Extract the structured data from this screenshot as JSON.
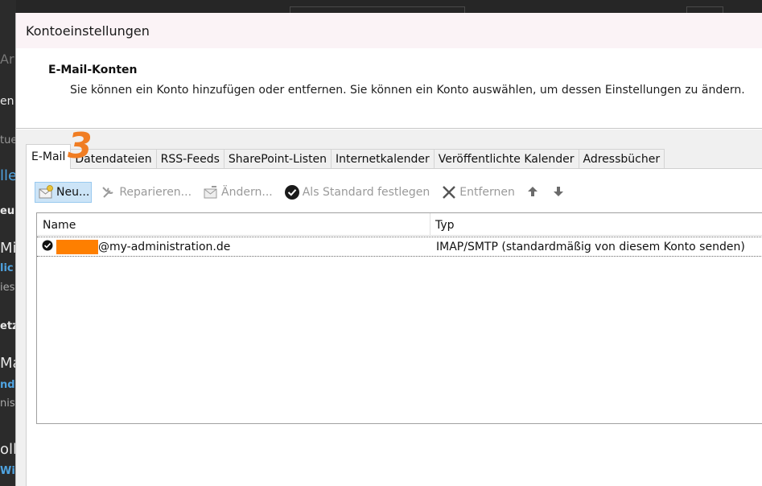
{
  "background": {
    "fragments": [
      "Ar",
      "en",
      "tue",
      "lle",
      "eu",
      "Mic",
      "lic",
      "ies",
      "etz",
      "Ma",
      "nd",
      "nis",
      "olli",
      "Will"
    ]
  },
  "dialog": {
    "title": "Kontoeinstellungen",
    "header_title": "E-Mail-Konten",
    "header_desc": "Sie können ein Konto hinzufügen oder entfernen. Sie können ein Konto auswählen, um dessen Einstellungen zu ändern."
  },
  "tabs": [
    {
      "label": "E-Mail",
      "active": true
    },
    {
      "label": "Datendateien"
    },
    {
      "label": "RSS-Feeds"
    },
    {
      "label": "SharePoint-Listen"
    },
    {
      "label": "Internetkalender"
    },
    {
      "label": "Veröffentlichte Kalender"
    },
    {
      "label": "Adressbücher"
    }
  ],
  "toolbar": {
    "new_label": "Neu...",
    "repair_label": "Reparieren...",
    "change_label": "Ändern...",
    "default_label": "Als Standard festlegen",
    "remove_label": "Entfernen"
  },
  "annotation": "3",
  "accounts_table": {
    "columns": [
      "Name",
      "Typ"
    ],
    "rows": [
      {
        "name_suffix": "@my-administration.de",
        "type": "IMAP/SMTP (standardmäßig von diesem Konto senden)"
      }
    ]
  },
  "colors": {
    "accent": "#f07d23",
    "redaction": "#fe7f00",
    "selected_button": "#cce4f7"
  }
}
